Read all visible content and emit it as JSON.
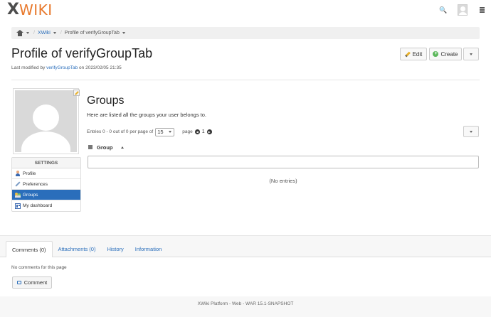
{
  "header": {
    "logo_x": "X",
    "logo_text": "WIKI",
    "search_icon": "search-icon",
    "avatar_icon": "user-avatar-icon",
    "menu_icon": "hamburger-menu-icon"
  },
  "breadcrumb": {
    "home_icon": "home-icon",
    "items": [
      "XWiki",
      "Profile of verifyGroupTab"
    ]
  },
  "page": {
    "title": "Profile of verifyGroupTab",
    "modified_prefix": "Last modified by",
    "modified_user": "verifyGroupTab",
    "modified_on": "on 2023/02/05 21:35"
  },
  "actions": {
    "edit_label": "Edit",
    "create_label": "Create"
  },
  "settings": {
    "heading": "SETTINGS",
    "items": [
      {
        "label": "Profile",
        "active": false
      },
      {
        "label": "Preferences",
        "active": false
      },
      {
        "label": "Groups",
        "active": true
      },
      {
        "label": "My dashboard",
        "active": false
      }
    ]
  },
  "groups": {
    "title": "Groups",
    "description": "Here are listed all the groups your user belongs to.",
    "entries_text": "Entries 0 - 0 out of 0 per page of",
    "per_page": "15",
    "page_label": "page",
    "page_number": "1",
    "column_header": "Group",
    "filter_value": "",
    "empty_text": "(No entries)"
  },
  "tabs": [
    {
      "label": "Comments (0)",
      "active": true
    },
    {
      "label": "Attachments (0)",
      "active": false
    },
    {
      "label": "History",
      "active": false
    },
    {
      "label": "Information",
      "active": false
    }
  ],
  "comments": {
    "empty_text": "No comments for this page",
    "button_label": "Comment"
  },
  "footer": {
    "text": "XWiki Platform - Web - WAR 15.1-SNAPSHOT"
  },
  "colors": {
    "accent": "#2a6ebb",
    "logo_orange": "#e8782b"
  }
}
